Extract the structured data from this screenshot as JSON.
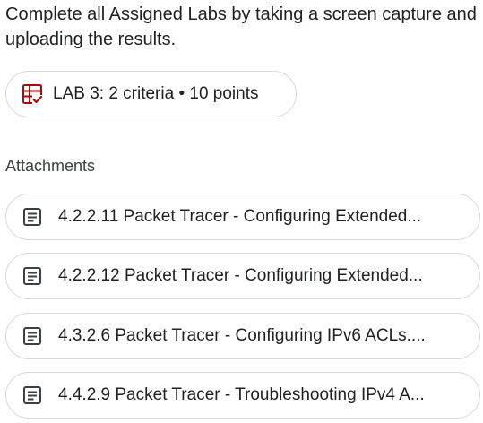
{
  "instructions": "Complete all Assigned Labs by taking a screen capture and uploading the results.",
  "rubric": {
    "label": "LAB 3: 2 criteria • 10 points",
    "icon": "rubric-icon",
    "icon_color": "#a50e0e"
  },
  "attachments": {
    "heading": "Attachments",
    "items": [
      {
        "label": "4.2.2.11 Packet Tracer - Configuring Extended...",
        "icon": "document-icon"
      },
      {
        "label": "4.2.2.12 Packet Tracer - Configuring Extended...",
        "icon": "document-icon"
      },
      {
        "label": "4.3.2.6 Packet Tracer - Configuring IPv6 ACLs....",
        "icon": "document-icon"
      },
      {
        "label": "4.4.2.9 Packet Tracer - Troubleshooting IPv4 A...",
        "icon": "document-icon"
      }
    ]
  }
}
